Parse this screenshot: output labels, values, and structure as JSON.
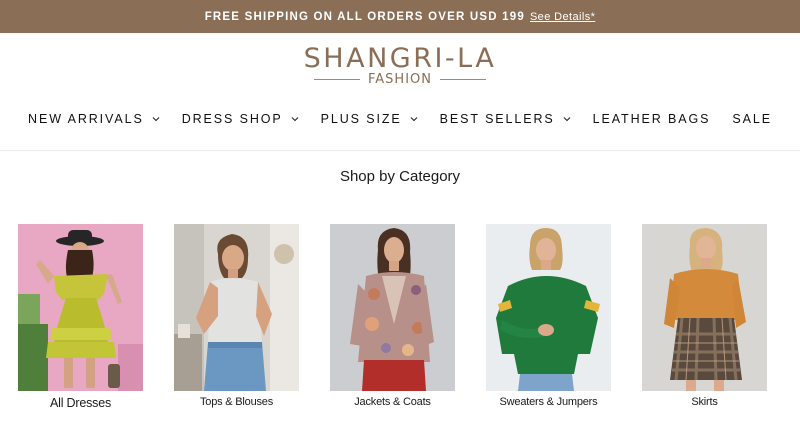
{
  "announcement": {
    "text": "FREE SHIPPING ON ALL ORDERS OVER USD 199",
    "link": "See Details*"
  },
  "logo": {
    "brand": "SHANGRI-LA",
    "sub": "FASHION"
  },
  "nav": {
    "items": [
      {
        "label": "NEW ARRIVALS",
        "has_dropdown": true
      },
      {
        "label": "DRESS SHOP",
        "has_dropdown": true
      },
      {
        "label": "PLUS SIZE",
        "has_dropdown": true
      },
      {
        "label": "BEST SELLERS",
        "has_dropdown": true
      },
      {
        "label": "LEATHER BAGS",
        "has_dropdown": false
      },
      {
        "label": "SALE",
        "has_dropdown": false
      }
    ]
  },
  "section": {
    "title": "Shop by Category"
  },
  "categories": [
    {
      "label": "All Dresses"
    },
    {
      "label": "Tops & Blouses"
    },
    {
      "label": "Jackets & Coats"
    },
    {
      "label": "Sweaters & Jumpers"
    },
    {
      "label": "Skirts"
    }
  ],
  "colors": {
    "brand": "#8a6e55",
    "announcement_bg": "#8a6e55"
  }
}
